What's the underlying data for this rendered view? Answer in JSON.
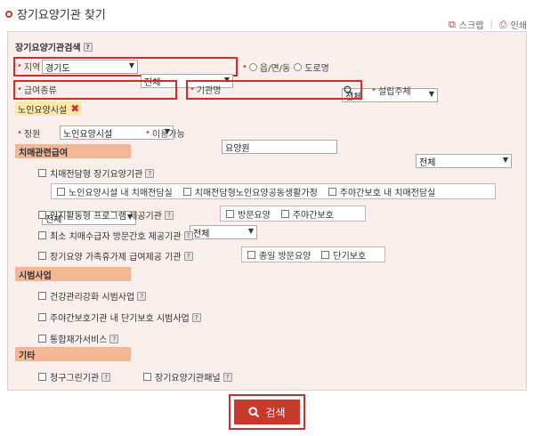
{
  "header": {
    "title": "장기요양기관 찾기",
    "scrap": "스크랩",
    "print": "인쇄",
    "separator": "|"
  },
  "form": {
    "title": "장기요양기관검색",
    "help": "?",
    "region": {
      "label": "지역",
      "province": "경기도",
      "district": "전체"
    },
    "address": {
      "option1": "읍/면/동",
      "option2": "도로명",
      "value": "전체"
    },
    "service_type": {
      "label": "급여종류",
      "value": "노인요양시설"
    },
    "institution_name": {
      "label": "기관명",
      "value": "요양원"
    },
    "founder": {
      "label": "설립주체",
      "value": "전체"
    },
    "selected_tag": "노인요양시설",
    "capacity": {
      "label": "정원",
      "value": "전체"
    },
    "availability": {
      "label": "이용가능",
      "value": "전체"
    }
  },
  "sections": {
    "dementia": {
      "title": "치매관련급여",
      "items": [
        "치매전담형 장기요양기관"
      ],
      "sub_items": [
        "노인요양시설 내 치매전담실",
        "치매전담형노인요양공동생활가정",
        "주야간보호 내 치매전담실"
      ],
      "cognitive": "인지활동형 프로그램 제공기관",
      "cognitive_sub": [
        "방문요양",
        "주야간보호"
      ],
      "min_visit": "최소 치매수급자 방문간호 제공기관",
      "family_leave": "장기요양 가족휴가제 급여제공 기관",
      "family_sub": [
        "종일 방문요양",
        "단기보호"
      ]
    },
    "pilot": {
      "title": "시범사업",
      "items": [
        "건강관리강화 시범사업",
        "주야간보호기관 내 단기보호 시범사업",
        "통합재가서비스"
      ]
    },
    "etc": {
      "title": "기타",
      "items": [
        "청구그린기관",
        "장기요양기관패널"
      ]
    }
  },
  "search_button": "검색",
  "colors": {
    "accent": "#c8392b",
    "highlight": "#d62b2b",
    "panel_bg": "#fbefec",
    "section_bg": "#f3b795",
    "tag_bg": "#fbe8a6"
  }
}
